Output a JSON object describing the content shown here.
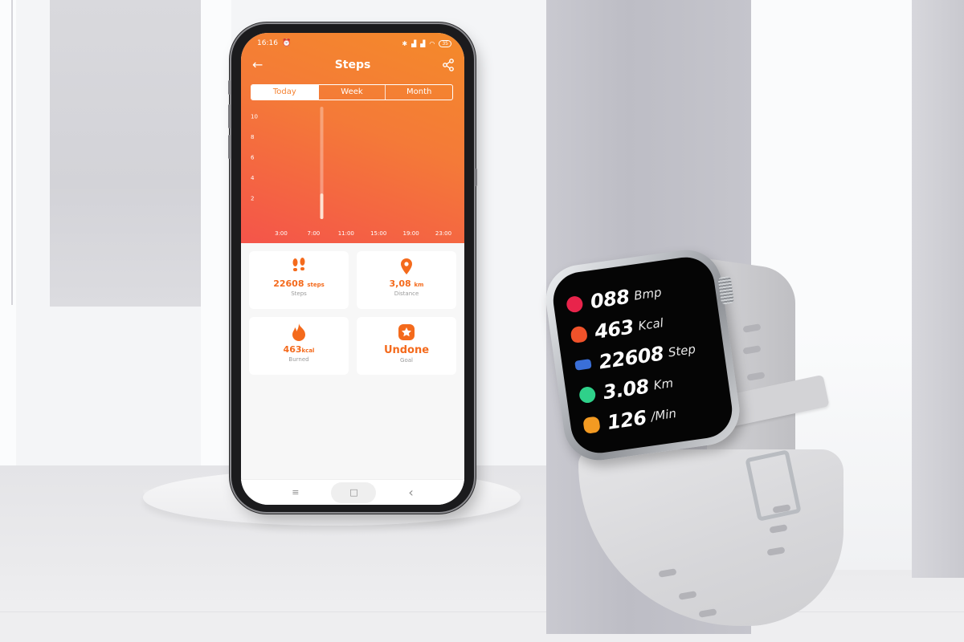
{
  "phone": {
    "status_bar": {
      "time": "16:16",
      "alarm_icon": "alarm-clock-icon",
      "battery": "35",
      "icons": [
        "bluetooth-icon",
        "signal-icon",
        "signal-icon",
        "wifi-icon",
        "battery-icon"
      ]
    },
    "header": {
      "back_icon": "arrow-left-icon",
      "title": "Steps",
      "share_icon": "share-icon"
    },
    "tabs": [
      {
        "label": "Today",
        "active": true
      },
      {
        "label": "Week",
        "active": false
      },
      {
        "label": "Month",
        "active": false
      }
    ],
    "stats": [
      {
        "icon": "footprints-icon",
        "value": "22608",
        "unit": "steps",
        "label": "Steps"
      },
      {
        "icon": "location-pin-icon",
        "value": "3,08",
        "unit": "km",
        "label": "Distance"
      },
      {
        "icon": "flame-icon",
        "value": "463",
        "unit": "kcal",
        "label": "Burned"
      },
      {
        "icon": "star-badge-icon",
        "value": "Undone",
        "unit": "",
        "label": "Goal"
      }
    ],
    "nav_bar": {
      "menu_icon": "≡",
      "home_icon": "□",
      "back_icon": "‹"
    },
    "colors": {
      "accent": "#f46a1c",
      "header_top": "#f48a2a",
      "header_bottom": "#f4544a"
    }
  },
  "chart_data": {
    "type": "bar",
    "title": "Steps",
    "xlabel": "",
    "ylabel": "",
    "x_ticks": [
      "3:00",
      "7:00",
      "11:00",
      "15:00",
      "19:00",
      "23:00"
    ],
    "y_ticks": [
      2,
      4,
      6,
      8,
      10
    ],
    "ylim": [
      0,
      11
    ],
    "grid": false,
    "series": [
      {
        "name": "Steps",
        "bars": [
          {
            "x": "8:00",
            "value": 2.5,
            "max_track": 11
          }
        ]
      }
    ]
  },
  "watch": {
    "rows": [
      {
        "icon": "heart-rate-icon",
        "color": "#e8244b",
        "value": "088",
        "unit": "Bmp"
      },
      {
        "icon": "flame-icon",
        "color": "#f0522a",
        "value": "463",
        "unit": "Kcal"
      },
      {
        "icon": "shoe-icon",
        "color": "#3a6fd8",
        "value": "22608",
        "unit": "Step"
      },
      {
        "icon": "location-icon",
        "color": "#2fd18a",
        "value": "3.08",
        "unit": "Km"
      },
      {
        "icon": "footprint-icon",
        "color": "#f39a22",
        "value": "126",
        "unit": "/Min"
      }
    ]
  }
}
